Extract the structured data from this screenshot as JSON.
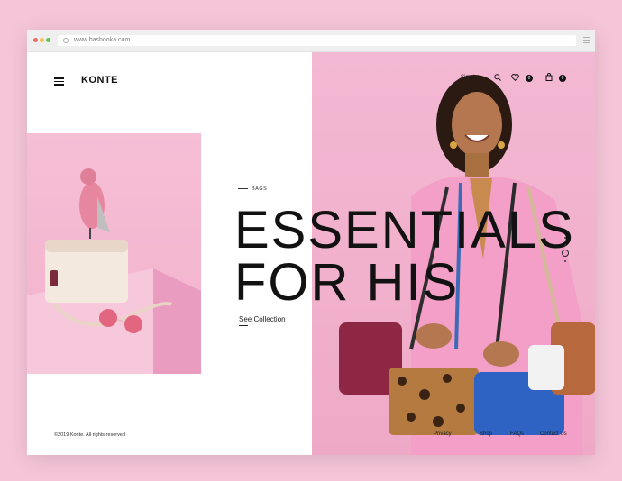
{
  "browser": {
    "url": "www.bashooka.com",
    "colors": {
      "close": "#ed6b60",
      "minimize": "#f5bf4f",
      "maximize": "#62c554"
    }
  },
  "header": {
    "logo": "KONTE",
    "signin_label": "Sign In",
    "wishlist_count": "0",
    "cart_count": "0"
  },
  "hero": {
    "category": "BAGS",
    "headline_line1": "ESSENTIALS",
    "headline_line2": "FOR HIS",
    "cta_label": "See Collection"
  },
  "footer": {
    "copyright": "©2019 Konte. All rights reserved",
    "links": [
      "Privacy",
      "Shop",
      "FAQs",
      "Contact Us"
    ]
  },
  "slider": {
    "total": 4,
    "active_index": 2
  }
}
